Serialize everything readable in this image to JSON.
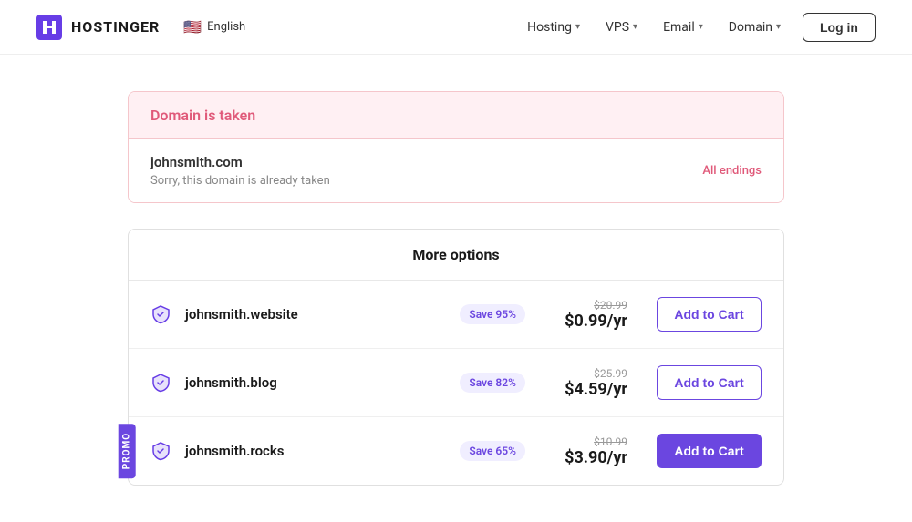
{
  "header": {
    "logo_text": "HOSTINGER",
    "lang_flag": "🇺🇸",
    "lang_label": "English",
    "nav": [
      {
        "label": "Hosting"
      },
      {
        "label": "VPS"
      },
      {
        "label": "Email"
      },
      {
        "label": "Domain"
      }
    ],
    "login_label": "Log in"
  },
  "domain_taken": {
    "title": "Domain is taken",
    "domain": "johnsmith.com",
    "sorry_text": "Sorry, this domain is already taken",
    "all_endings_label": "All endings"
  },
  "more_options": {
    "title": "More options",
    "domains": [
      {
        "name": "johnsmith.website",
        "save_badge": "Save 95%",
        "original_price": "$20.99",
        "current_price": "$0.99/yr",
        "btn_label": "Add to Cart",
        "filled": false,
        "promo": false
      },
      {
        "name": "johnsmith.blog",
        "save_badge": "Save 82%",
        "original_price": "$25.99",
        "current_price": "$4.59/yr",
        "btn_label": "Add to Cart",
        "filled": false,
        "promo": false
      },
      {
        "name": "johnsmith.rocks",
        "save_badge": "Save 65%",
        "original_price": "$10.99",
        "current_price": "$3.90/yr",
        "btn_label": "Add to Cart",
        "filled": true,
        "promo": true,
        "promo_label": "PROMO"
      }
    ]
  }
}
